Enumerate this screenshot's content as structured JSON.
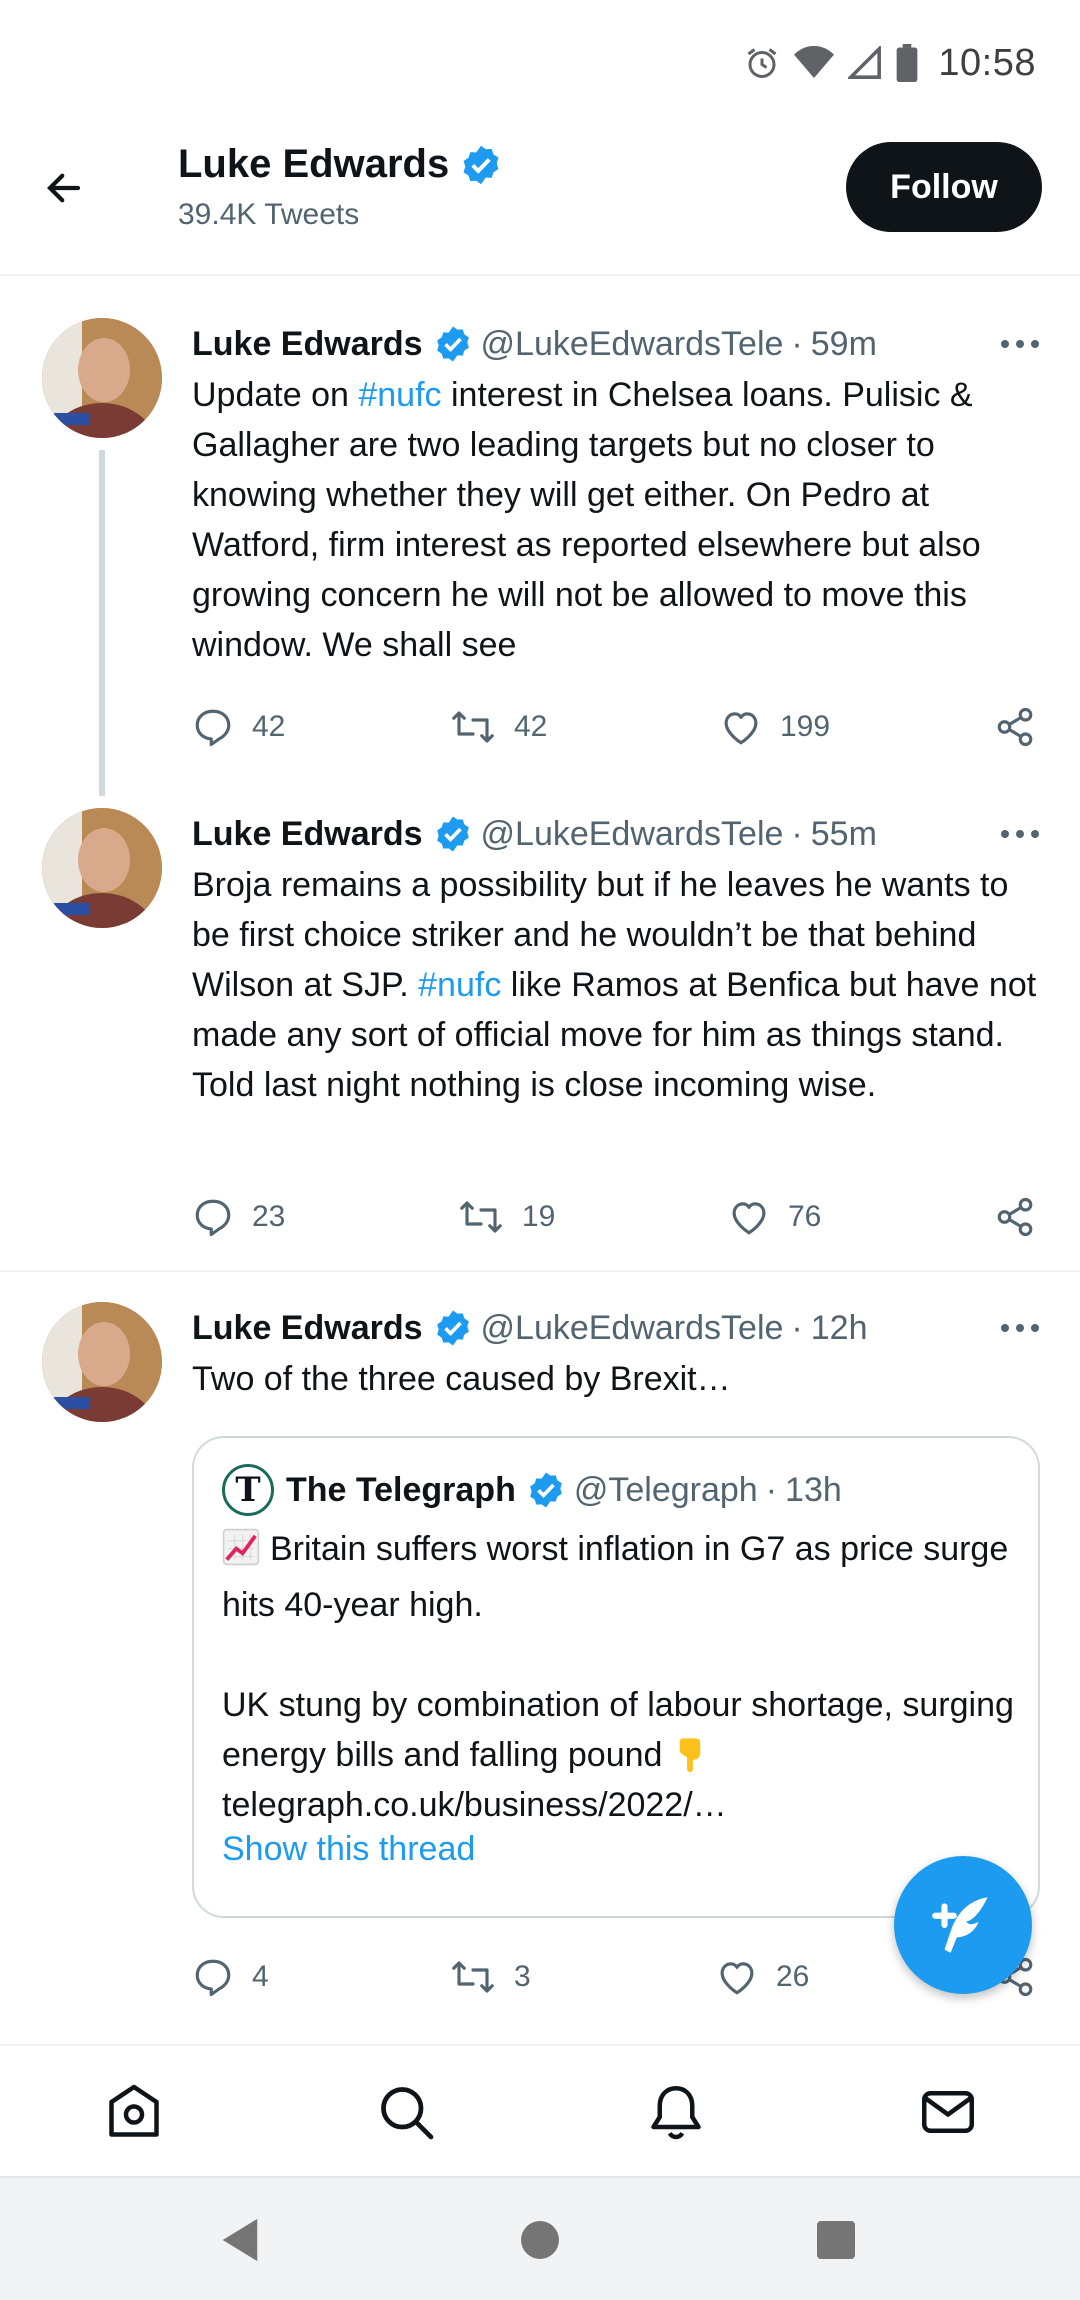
{
  "status_bar": {
    "time": "10:58"
  },
  "header": {
    "name": "Luke Edwards",
    "tweet_count": "39.4K Tweets",
    "follow_label": "Follow"
  },
  "tweets": [
    {
      "name": "Luke Edwards",
      "handle": "@LukeEdwardsTele",
      "dot": "·",
      "time": "59m",
      "text_parts": [
        "Update on ",
        "#nufc",
        " interest in Chelsea loans. Pulisic & Gallagher are two leading targets but no closer to knowing whether they will get either. On Pedro at Watford, firm interest as reported elsewhere but also growing concern he will not be allowed to move this window. We shall see"
      ],
      "replies": "42",
      "retweets": "42",
      "likes": "199"
    },
    {
      "name": "Luke Edwards",
      "handle": "@LukeEdwardsTele",
      "dot": "·",
      "time": "55m",
      "text_parts": [
        "Broja remains a possibility but if he leaves he wants to be first choice striker and he wouldn’t be that behind Wilson at SJP. ",
        "#nufc",
        " like Ramos at Benfica but have not made any sort of official move for him as things stand. Told last night nothing is close incoming wise."
      ],
      "replies": "23",
      "retweets": "19",
      "likes": "76"
    },
    {
      "name": "Luke Edwards",
      "handle": "@LukeEdwardsTele",
      "dot": "·",
      "time": "12h",
      "text": "Two of the three caused by Brexit…",
      "replies": "4",
      "retweets": "3",
      "likes": "26",
      "quote": {
        "name": "The Telegraph",
        "handle": "@Telegraph",
        "dot": "·",
        "time": "13h",
        "line1": "Britain suffers worst inflation in G7 as price surge hits 40-year high.",
        "line2": "UK stung by combination of labour shortage, surging energy bills and falling pound",
        "link": "telegraph.co.uk/business/2022/…",
        "show_thread": "Show this thread"
      }
    }
  ],
  "colors": {
    "accent": "#1d9bf0",
    "text": "#0f1419",
    "secondary": "#536471",
    "border": "#eff3f4"
  },
  "icons": {
    "status": [
      "alarm-icon",
      "wifi-icon",
      "signal-icon",
      "battery-icon"
    ],
    "nav": [
      "home-icon",
      "search-icon",
      "notifications-icon",
      "messages-icon"
    ]
  }
}
